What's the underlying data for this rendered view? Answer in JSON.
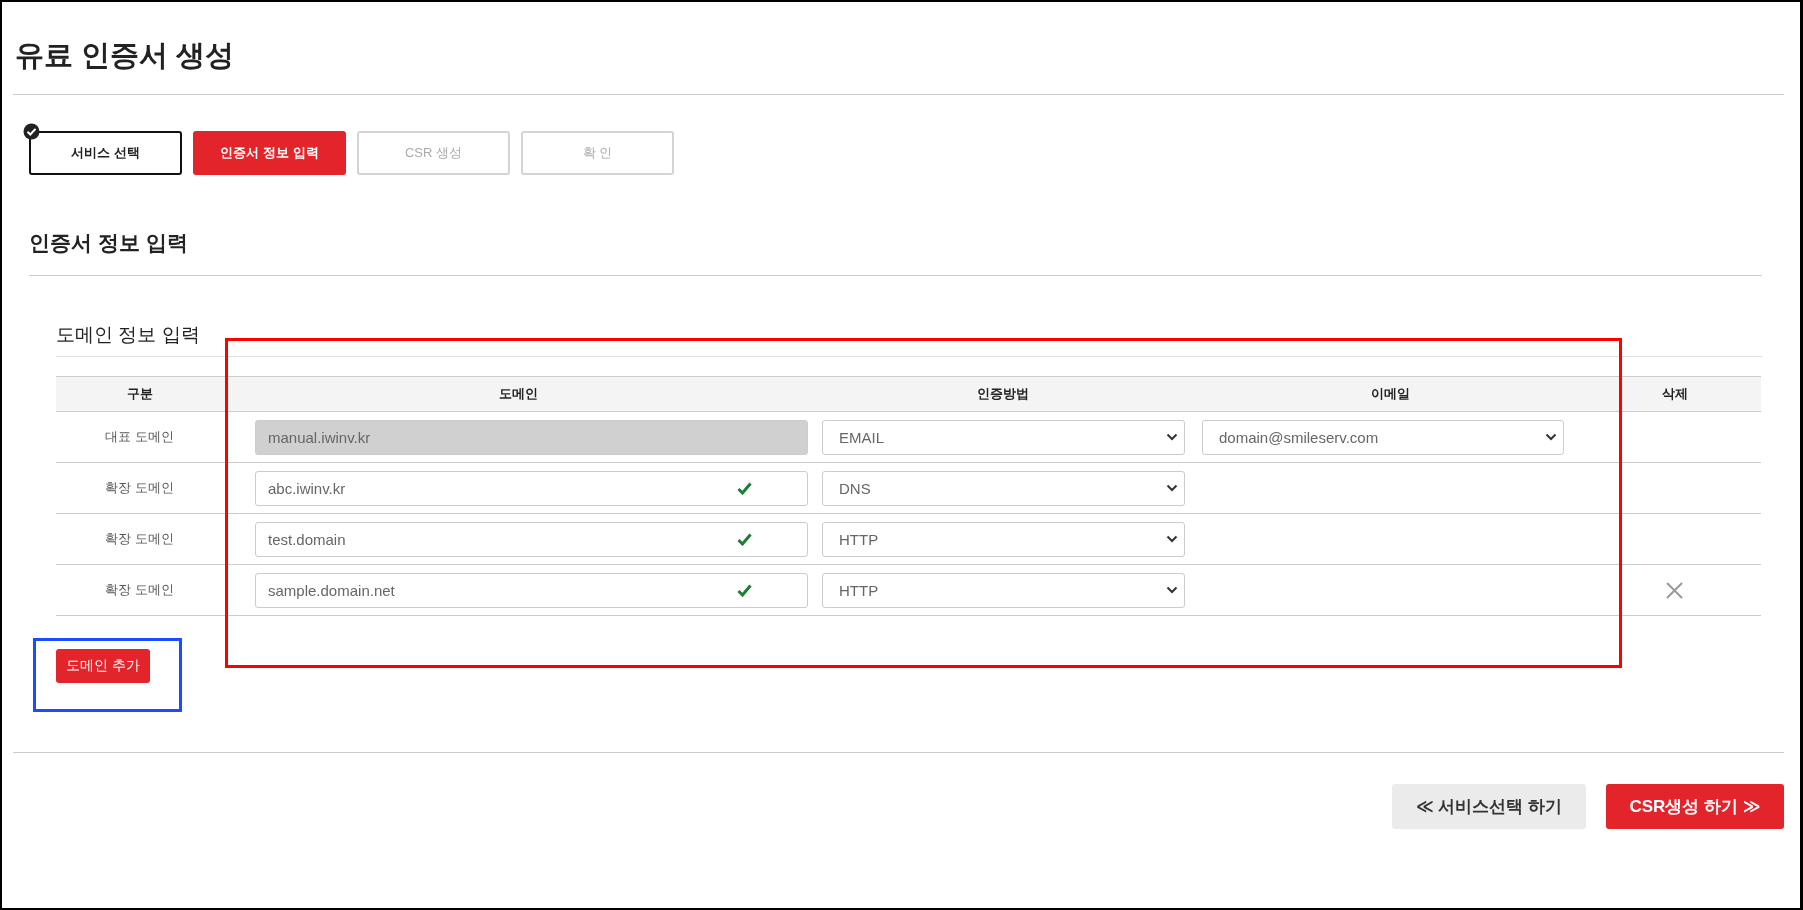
{
  "page_title": "유료 인증서 생성",
  "steps": [
    {
      "label": "서비스 선택",
      "completed": true,
      "selected": false
    },
    {
      "label": "인증서 정보 입력",
      "completed": false,
      "selected": true
    },
    {
      "label": "CSR 생성",
      "completed": false,
      "selected": false
    },
    {
      "label": "확 인",
      "completed": false,
      "selected": false
    }
  ],
  "section_title": "인증서 정보 입력",
  "subsection_title": "도메인 정보 입력",
  "table": {
    "columns": [
      "구분",
      "도메인",
      "인증방법",
      "이메일",
      "삭제"
    ],
    "rows": [
      {
        "type": "대표 도메인",
        "domain": "manual.iwinv.kr",
        "disabled": true,
        "verified": false,
        "method": "EMAIL",
        "email": "domain@smileserv.com",
        "deletable": false
      },
      {
        "type": "확장 도메인",
        "domain": "abc.iwinv.kr",
        "disabled": false,
        "verified": true,
        "method": "DNS",
        "deletable": false
      },
      {
        "type": "확장 도메인",
        "domain": "test.domain",
        "disabled": false,
        "verified": true,
        "method": "HTTP",
        "deletable": false
      },
      {
        "type": "확장 도메인",
        "domain": "sample.domain.net",
        "disabled": false,
        "verified": true,
        "method": "HTTP",
        "deletable": true
      }
    ]
  },
  "add_button": "도메인 추가",
  "annotations": [
    {
      "color": "#ff0000"
    },
    {
      "color": "#1a4dff"
    }
  ],
  "footer_buttons": [
    {
      "label": "≪ 서비스선택 하기",
      "kind": "secondary"
    },
    {
      "label": "CSR생성 하기 ≫",
      "kind": "primary"
    }
  ]
}
